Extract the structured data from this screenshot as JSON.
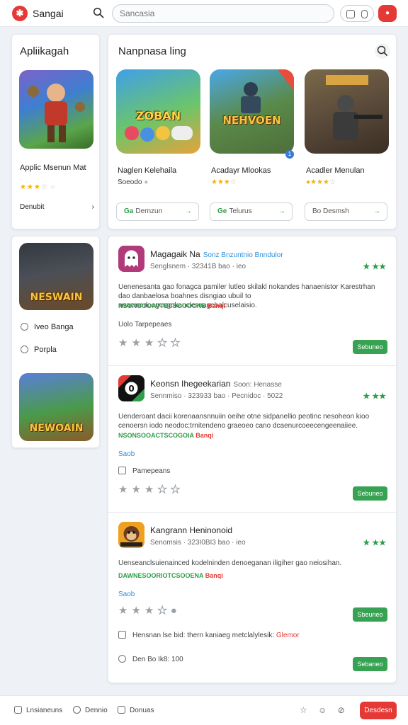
{
  "header": {
    "app_title": "Sangai",
    "search_placeholder": "Sancasia",
    "avatar_label": "●"
  },
  "sidebar": {
    "title": "Apliikagah",
    "featured_name": "Applic Msenun Mat",
    "featured_link": "Denubit",
    "featured_link_arrow": "›",
    "banner_text": "NESWAIN",
    "banner2_text": "NEWOAIN",
    "items": [
      {
        "label": "Iveo Banga"
      },
      {
        "label": "Porpla"
      }
    ]
  },
  "popular": {
    "title": "Nanpnasa ling",
    "games": [
      {
        "name": "Naglen Kelehaila",
        "meta": "Soeodo",
        "stars": "",
        "btn_prefix": "Ga",
        "btn_label": "Dernzun",
        "art": "ZOBAN"
      },
      {
        "name": "Acadayr Mlookas",
        "meta": "",
        "stars": "★★★",
        "btn_prefix": "Ge",
        "btn_label": "Telurus",
        "art": "NEHVOEN"
      },
      {
        "name": "Acadler Menulan",
        "meta": "",
        "stars": "★★★",
        "btn_prefix": "",
        "btn_label": "Bo Desmsh",
        "art": ""
      }
    ],
    "badge": "1"
  },
  "reviews": [
    {
      "title": "Magagaik Na",
      "tag": "Sonz Bnzuntnio Bnndulor",
      "sub": "Senglsnem · 32341B bao · ieo",
      "rating": "★ ★★",
      "body": "Uenenesanta gao fonagca pamiler lutleo skilakl nokandes hanaenistor Karestrhan dao danbaelosa boahnes disngiao ubuil to aoacmedoogcngokanclesnagebalcuselaisio.",
      "green": "NSONGOOAVTECSOOOONE",
      "green_red": "Banqi",
      "extra": "Uolo Tarpepeaes",
      "button": "Sebuneo"
    },
    {
      "title": "Keonsn Ihegeekarian",
      "tag": "Soon: Henasse",
      "sub": "Sennmiso · 323933 bao · Pecnidoc · 5022",
      "rating": "★ ★★",
      "body": "Uenderoant dacii korenaansnnuiin oeihe otne sidpanellio peotinc nesoheon kioo cenoersn iodo neodoc;trnitendeno graeoeo cano dcaenurcoeecengeenaiiee.",
      "green": "NSONSOOACTSCOGOIA",
      "green_red": "Banqi",
      "link": "Saob",
      "line": "Pamepeans",
      "button": "Sebuneo"
    },
    {
      "title": "Kangrann Heninonoid",
      "tag": "",
      "sub": "Senomsis · 323I0BI3 bao · ieo",
      "rating": "★ ★★",
      "body": "Uenseanclsuienainced kodelninden denoeganan iligiher gao neiosihan.",
      "green": "DAWNESOORIOTCSOOENA",
      "green_red": "Banqi",
      "link": "Saob",
      "line": "Hensnan lse bid: thern kaniaeg metclalylesik:",
      "line_red": "Glemor",
      "line2": "Den Bo Ik8: 100",
      "button": "Sbeuneo",
      "button2": "Sebaneo"
    }
  ],
  "footer": {
    "items": [
      {
        "label": "Lnsianeuns"
      },
      {
        "label": "Dennio"
      },
      {
        "label": "Donuas"
      }
    ],
    "icons": "☆ ☺ ⊘",
    "button": "Desdesn"
  },
  "colors": {
    "brand_red": "#e53935",
    "accent_green": "#37a352",
    "link_blue": "#2f8fd8",
    "star_gold": "#f4b400"
  }
}
